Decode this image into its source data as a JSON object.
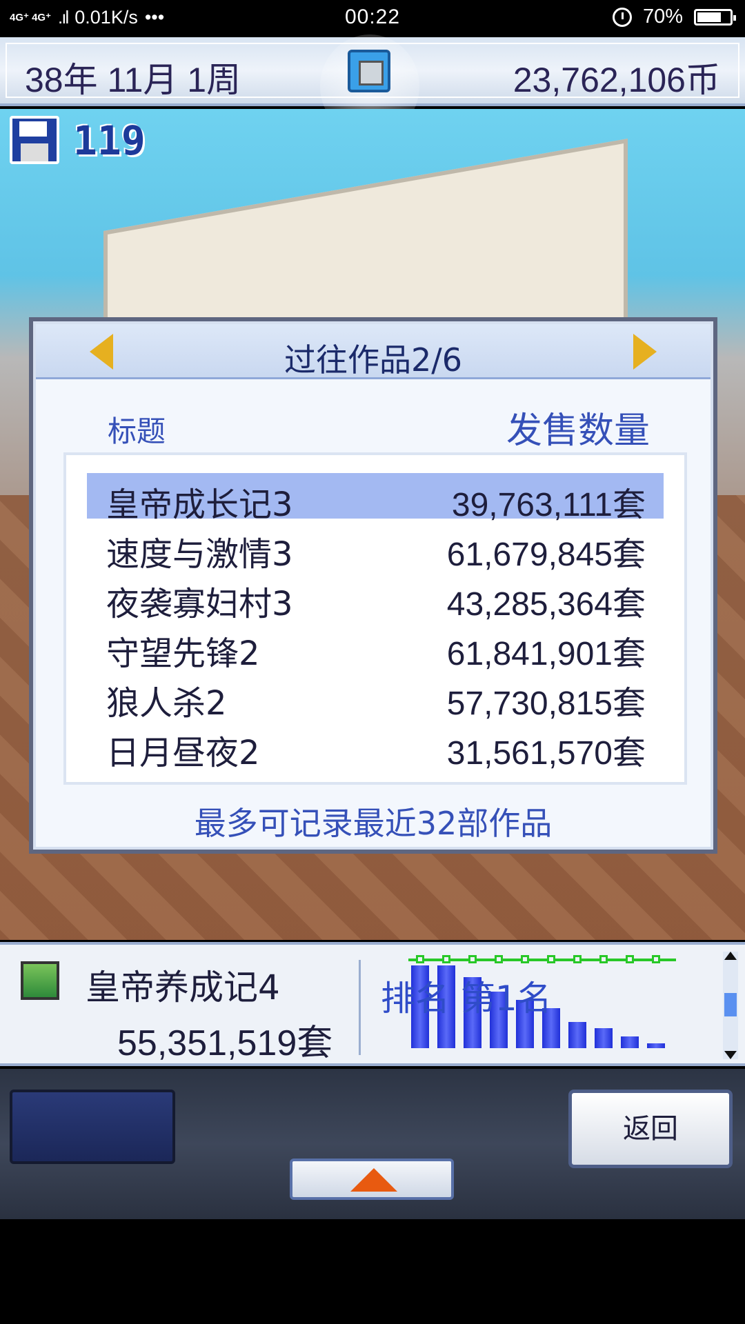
{
  "status_bar": {
    "network": "4G⁺ 4G⁺",
    "signal": ".ıl",
    "speed": "0.01K/s",
    "dots": "•••",
    "time": "00:22",
    "battery": "70%"
  },
  "header": {
    "date": "38年 11月 1周",
    "money": "23,762,106币"
  },
  "save_count": "119",
  "dialog": {
    "title": "过往作品2/6",
    "col_title": "标题",
    "col_sales": "发售数量",
    "rows": [
      {
        "name": "皇帝成长记3",
        "sales": "39,763,111套"
      },
      {
        "name": "速度与激情3",
        "sales": "61,679,845套"
      },
      {
        "name": "夜袭寡妇村3",
        "sales": "43,285,364套"
      },
      {
        "name": "守望先锋2",
        "sales": "61,841,901套"
      },
      {
        "name": "狼人杀2",
        "sales": "57,730,815套"
      },
      {
        "name": "日月昼夜2",
        "sales": "31,561,570套"
      }
    ],
    "footer": "最多可记录最近32部作品"
  },
  "info_panel": {
    "game_name": "皇帝养成记4",
    "game_sales": "55,351,519套",
    "ranking": "排名 第1名"
  },
  "chart_data": {
    "type": "bar",
    "values": [
      100,
      100,
      86,
      68,
      58,
      48,
      32,
      24,
      14,
      6
    ],
    "colors": {
      "bar": "#2030d8",
      "line": "#28c828"
    }
  },
  "controls": {
    "back_label": "返回"
  }
}
